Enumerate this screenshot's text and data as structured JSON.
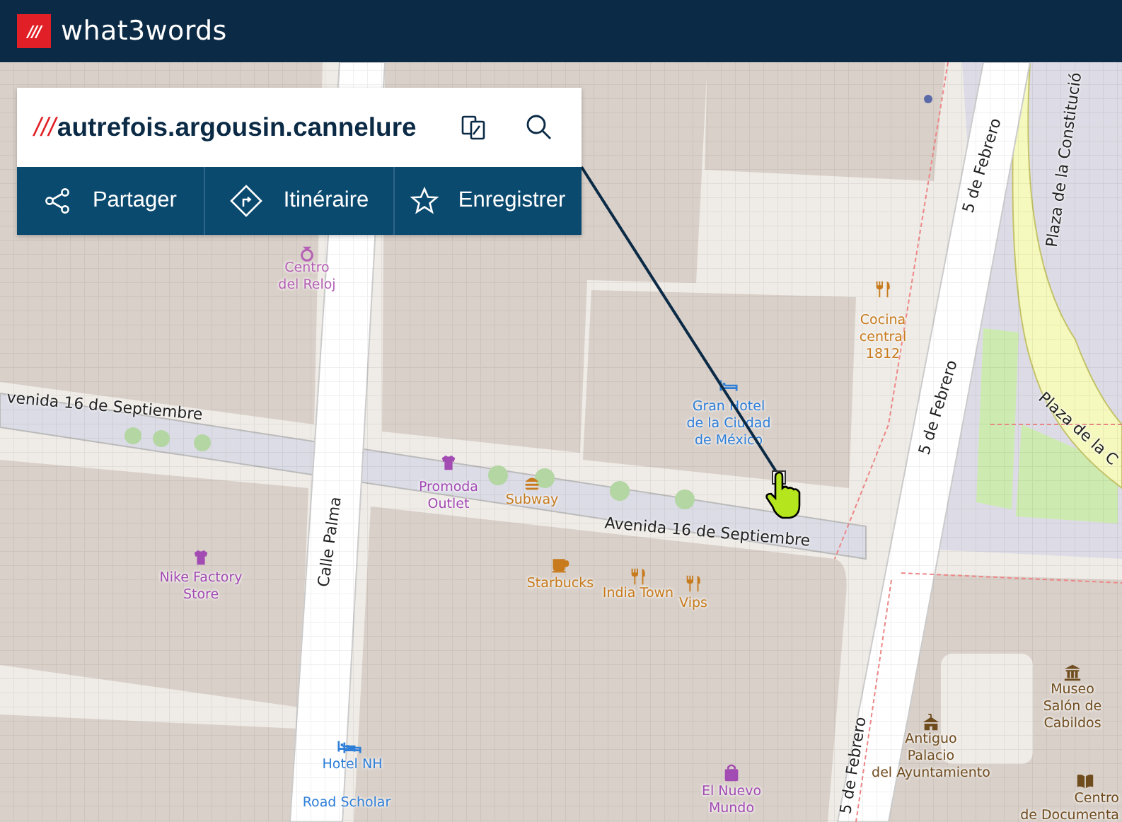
{
  "header": {
    "logo_mark": "///",
    "brand": "what3words"
  },
  "address": {
    "prefix": "///",
    "words": "autrefois.argousin.cannelure"
  },
  "actions": [
    {
      "label": "Partager",
      "kind": "share"
    },
    {
      "label": "Itinéraire",
      "kind": "route"
    },
    {
      "label": "Enregistrer",
      "kind": "save"
    }
  ],
  "map": {
    "places": [
      {
        "lines": [
          "Centro",
          "del Reloj"
        ],
        "kind": "clock"
      },
      {
        "lines": [
          "Cocina",
          "central",
          "1812"
        ],
        "kind": "restaurant"
      },
      {
        "lines": [
          "Gran Hotel",
          "de la Ciudad",
          "de México"
        ],
        "kind": "hotel"
      },
      {
        "lines": [
          "Promoda",
          "Outlet"
        ],
        "kind": "clothes"
      },
      {
        "lines": [
          "Subway"
        ],
        "kind": "fast_food"
      },
      {
        "lines": [
          "Nike Factory",
          "Store"
        ],
        "kind": "clothes"
      },
      {
        "lines": [
          "Starbucks"
        ],
        "kind": "cafe"
      },
      {
        "lines": [
          "India Town"
        ],
        "kind": "restaurant"
      },
      {
        "lines": [
          "Vips"
        ],
        "kind": "restaurant"
      },
      {
        "lines": [
          "Museo",
          "Salón de",
          "Cabildos"
        ],
        "kind": "museum"
      },
      {
        "lines": [
          "Hotel NH"
        ],
        "kind": "hotel"
      },
      {
        "lines": [
          "Antiguo",
          "Palacio",
          "del Ayuntamiento"
        ],
        "kind": "townhall"
      },
      {
        "lines": [
          "Road Scholar"
        ],
        "kind": "hotel"
      },
      {
        "lines": [
          "El Nuevo",
          "Mundo"
        ],
        "kind": "department_store"
      },
      {
        "lines": [
          "Centro",
          "de Documenta"
        ],
        "kind": "library"
      }
    ],
    "streets": [
      {
        "name": "venida 16 de Septiembre"
      },
      {
        "name": "Avenida 16 de Septiembre"
      },
      {
        "name": "Calle Palma"
      },
      {
        "name": "5 de Febrero"
      },
      {
        "name": "5 de Febrero"
      },
      {
        "name": "5 de Febrero"
      },
      {
        "name": "Plaza de la Constitució"
      },
      {
        "name": "Plaza de la C"
      }
    ]
  }
}
